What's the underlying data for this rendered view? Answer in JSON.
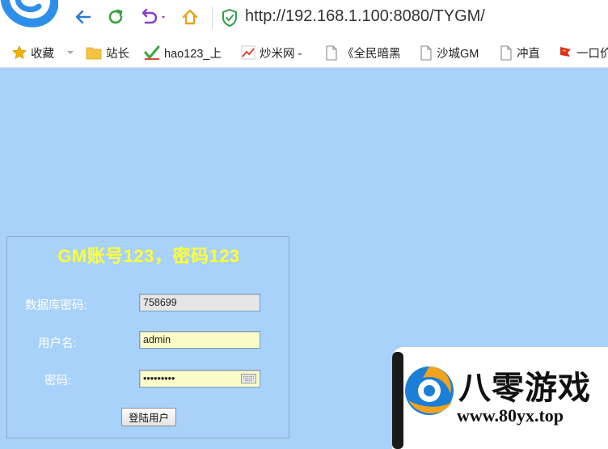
{
  "browser": {
    "url": "http://192.168.1.100:8080/TYGM/",
    "brand_color": "#2f8fe8"
  },
  "bookmarks": [
    {
      "label": "收藏",
      "icon": "star-icon"
    },
    {
      "label": "站长",
      "icon": "folder-icon"
    },
    {
      "label": "hao123_上",
      "icon": "hao123-icon"
    },
    {
      "label": "炒米网 -",
      "icon": "chart-icon"
    },
    {
      "label": "《全民暗黑",
      "icon": "page-icon"
    },
    {
      "label": "沙城GM",
      "icon": "page-icon"
    },
    {
      "label": "冲直",
      "icon": "page-icon"
    },
    {
      "label": "一口价",
      "icon": "flag-icon"
    }
  ],
  "login": {
    "title": "GM账号123，密码123",
    "db_password_label": "数据库密码:",
    "db_password_value": "758699",
    "username_label": "用户名:",
    "username_value": "admin",
    "password_label": "密码:",
    "password_value": "123456789",
    "submit_label": "登陆用户"
  },
  "watermark": {
    "name": "八零游戏",
    "url": "www.80yx.top"
  },
  "colors": {
    "page_bg": "#a9d2fa",
    "title": "#ffff33",
    "field_yellow": "#fafcc8"
  }
}
